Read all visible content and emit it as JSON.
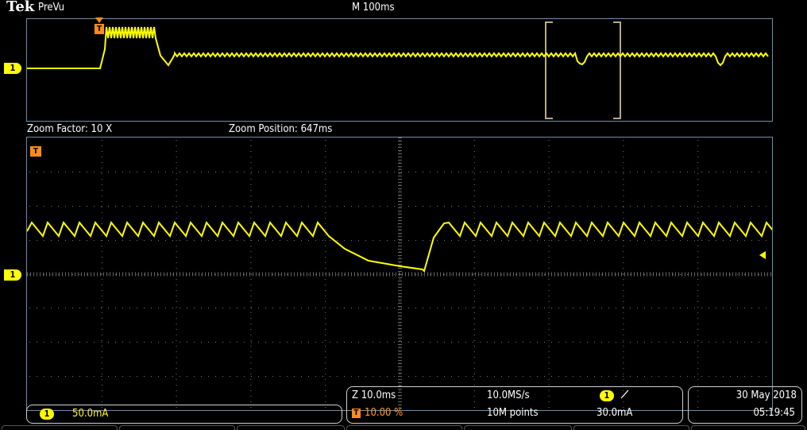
{
  "header": {
    "brand": "Tek",
    "mode": "PreVu",
    "timebase": "M 100ms"
  },
  "overview": {
    "channel_marker": "1",
    "trigger_marker": "T"
  },
  "zoom": {
    "factor_label": "Zoom Factor: 10 X",
    "position_label": "Zoom Position: 647ms",
    "channel_marker": "1",
    "trigger_marker": "T"
  },
  "status": {
    "channel": {
      "badge": "1",
      "scale": "50.0mA"
    },
    "timing": {
      "zoom_scale": "Z 10.0ms",
      "trigger_marker": "T",
      "trigger_position": "10.00 %",
      "sample_rate": "10.0MS/s",
      "record_length": "10M points"
    },
    "trigger": {
      "badge": "1",
      "slope_icon": "rising-edge",
      "level": "30.0mA"
    },
    "datetime": {
      "date": "30 May 2018",
      "time": "05:19:45"
    }
  },
  "colors": {
    "trace": "#ffff00",
    "trigger": "#ff8c1a",
    "grid_frame": "#6f8fa8",
    "background": "#000000"
  }
}
